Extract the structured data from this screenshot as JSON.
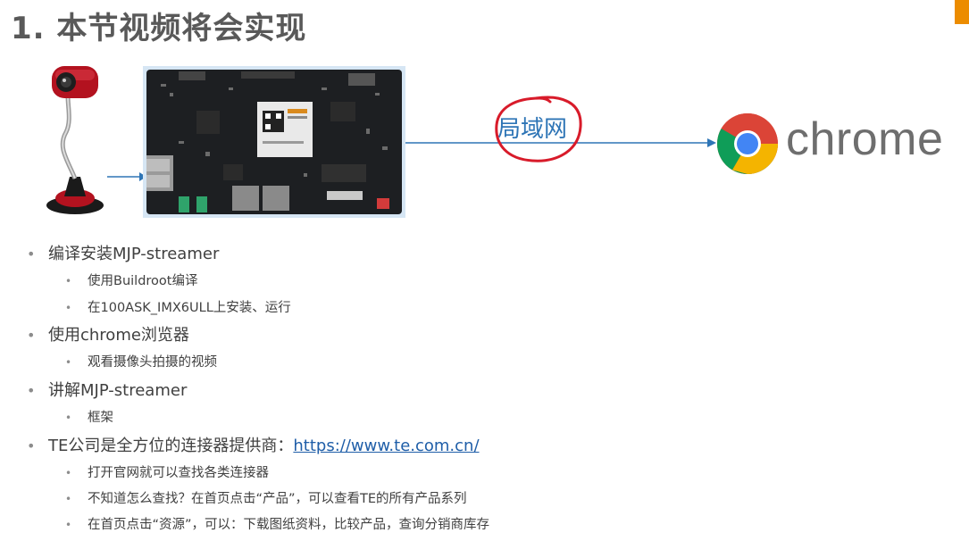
{
  "title": "1. 本节视频将会实现",
  "diagram": {
    "lan_label": "局域网",
    "chrome_text": "chrome",
    "accent_color": "#ec8c00",
    "annotation_color": "#d81b2a",
    "arrow_color": "#2e75b6"
  },
  "bullets": [
    {
      "text": "编译安装MJP-streamer",
      "sub": [
        "使用Buildroot编译",
        "在100ASK_IMX6ULL上安装、运行"
      ]
    },
    {
      "text": "使用chrome浏览器",
      "sub": [
        "观看摄像头拍摄的视频"
      ]
    },
    {
      "text": "讲解MJP-streamer",
      "sub": [
        "框架"
      ]
    },
    {
      "text": "TE公司是全方位的连接器提供商：",
      "link": "https://www.te.com.cn/",
      "sub": [
        "打开官网就可以查找各类连接器",
        "不知道怎么查找？在首页点击“产品”，可以查看TE的所有产品系列",
        "在首页点击“资源”，可以：下载图纸资料，比较产品，查询分销商库存"
      ]
    }
  ]
}
